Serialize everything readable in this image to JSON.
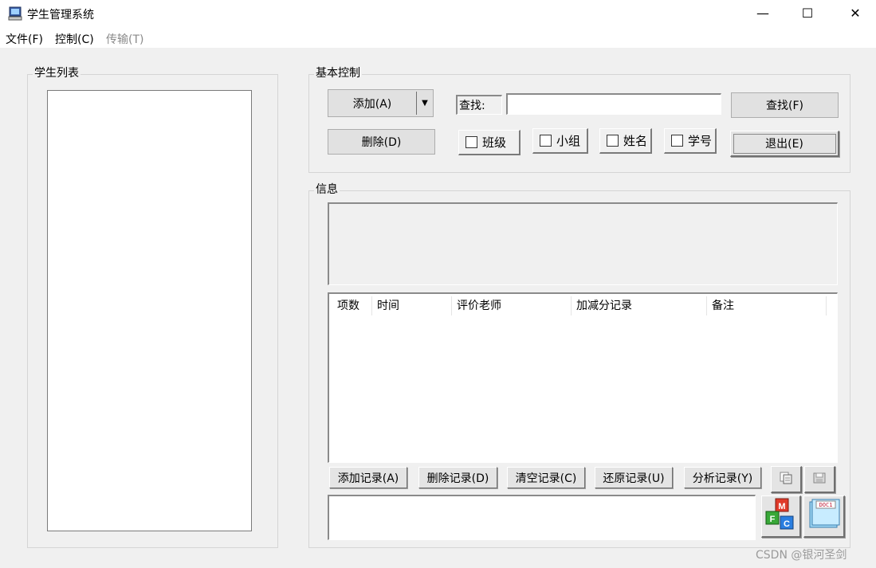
{
  "window": {
    "title": "学生管理系统",
    "minimize": "—",
    "maximize": "☐",
    "close": "✕"
  },
  "menu": [
    {
      "label": "文件(F)",
      "enabled": true
    },
    {
      "label": "控制(C)",
      "enabled": true
    },
    {
      "label": "传输(T)",
      "enabled": false
    }
  ],
  "student_list": {
    "title": "学生列表"
  },
  "basic_control": {
    "title": "基本控制",
    "add_label": "添加(A)",
    "delete_label": "删除(D)",
    "search_label": "查找:",
    "search_value": "",
    "find_label": "查找(F)",
    "exit_label": "退出(E)",
    "filters": [
      {
        "label": "班级",
        "checked": false
      },
      {
        "label": "小组",
        "checked": false
      },
      {
        "label": "姓名",
        "checked": false
      },
      {
        "label": "学号",
        "checked": false
      }
    ]
  },
  "info": {
    "title": "信息",
    "columns": [
      "项数",
      "时间",
      "评价老师",
      "加减分记录",
      "备注"
    ],
    "record_buttons": [
      "添加记录(A)",
      "删除记录(D)",
      "清空记录(C)",
      "还原记录(U)",
      "分析记录(Y)"
    ],
    "doc_icon_text": "DOC1",
    "mfc_icon_letters": [
      "M",
      "F",
      "C"
    ]
  },
  "watermark": "CSDN @银河圣剑",
  "colors": {
    "window_bg": "#f0f0f0",
    "titlebar_bg": "#ffffff",
    "disabled_text": "#8a8a8a"
  }
}
